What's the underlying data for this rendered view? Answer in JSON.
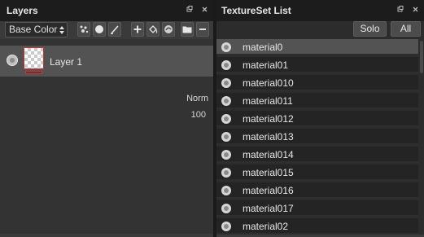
{
  "layers_panel": {
    "title": "Layers",
    "header_controls": [
      "pin-icon",
      "close-icon"
    ],
    "toolbar": {
      "channel_select": "Base Color",
      "buttons": [
        "add-effect-icon",
        "circle-icon",
        "brush-icon",
        "plus-icon",
        "fill-icon",
        "smart-material-icon",
        "folder-icon",
        "minus-icon"
      ]
    },
    "layer": {
      "name": "Layer 1",
      "blend_mode": "Norm",
      "opacity": "100",
      "visible": true
    }
  },
  "textureset_panel": {
    "title": "TextureSet List",
    "header_controls": [
      "pin-icon",
      "close-icon"
    ],
    "buttons": {
      "solo": "Solo",
      "all": "All"
    },
    "items": [
      {
        "label": "material0",
        "selected": true
      },
      {
        "label": "material01",
        "selected": false
      },
      {
        "label": "material010",
        "selected": false
      },
      {
        "label": "material011",
        "selected": false
      },
      {
        "label": "material012",
        "selected": false
      },
      {
        "label": "material013",
        "selected": false
      },
      {
        "label": "material014",
        "selected": false
      },
      {
        "label": "material015",
        "selected": false
      },
      {
        "label": "material016",
        "selected": false
      },
      {
        "label": "material017",
        "selected": false
      },
      {
        "label": "material02",
        "selected": false
      }
    ]
  },
  "colors": {
    "panel_bg": "#333333",
    "header_bg": "#1c1c1c",
    "selected_row": "#535353",
    "list_row": "#242424",
    "layer_thumb_border": "#c83434"
  }
}
